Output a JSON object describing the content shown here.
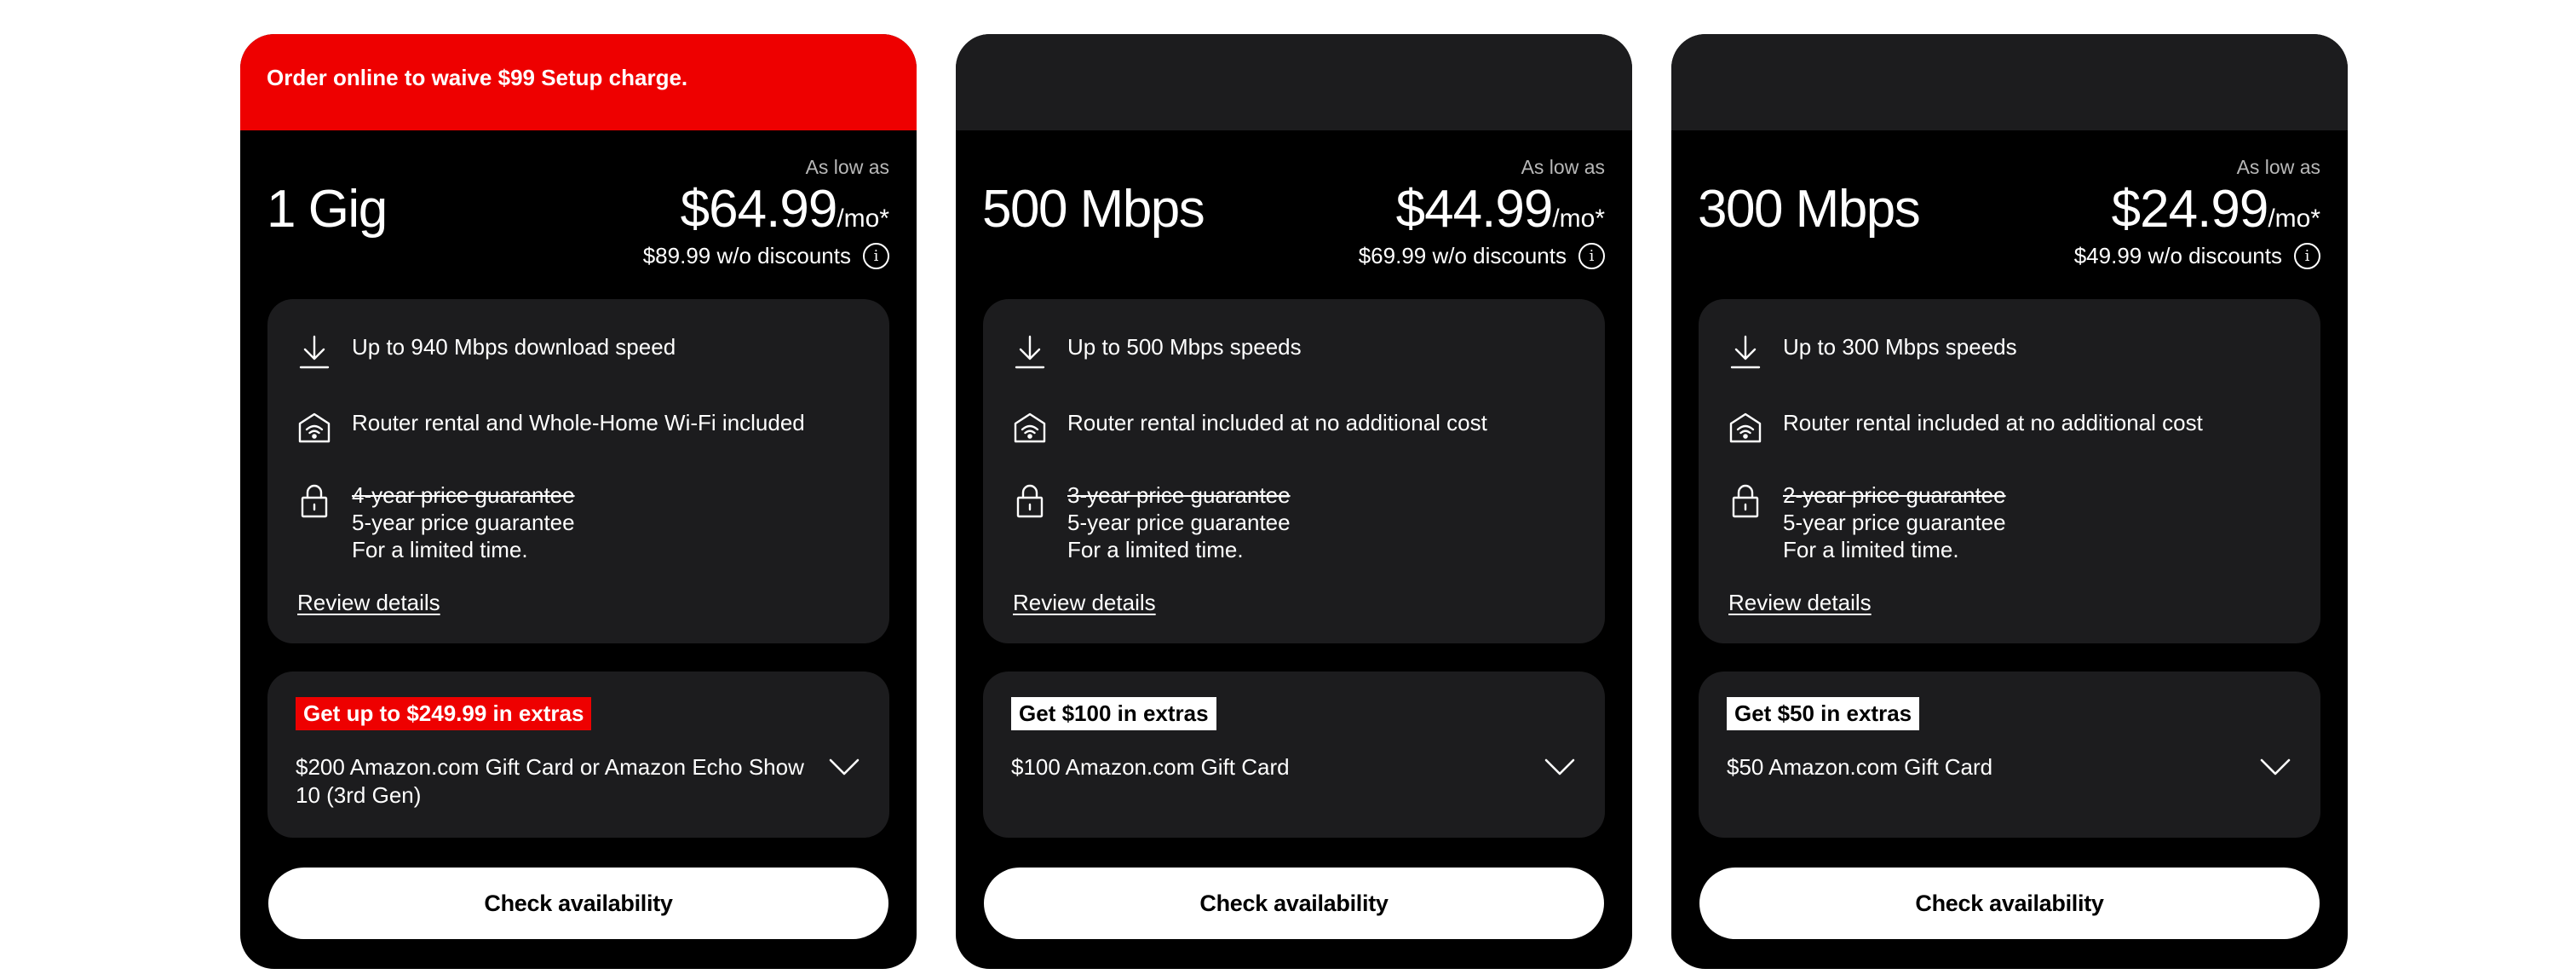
{
  "colors": {
    "brand_red": "#ee0000",
    "card_bg": "#000000",
    "panel_bg": "#1c1c1e",
    "muted_text": "#b8b8b8"
  },
  "cards": [
    {
      "promo": "Order online to waive $99 Setup charge.",
      "plan_name": "1 Gig",
      "as_low_as": "As low as",
      "price": "$64.99",
      "price_unit": "/mo*",
      "without_discounts": "$89.99 w/o discounts",
      "features": [
        {
          "icon": "download-icon",
          "text": "Up to 940 Mbps download speed"
        },
        {
          "icon": "wifi-home-icon",
          "text": "Router rental and Whole-Home Wi-Fi included"
        },
        {
          "icon": "lock-icon",
          "old": "4-year price guarantee",
          "new": "5-year price guarantee",
          "note": "For a limited time."
        }
      ],
      "review_label": "Review details",
      "extras_badge": "Get up to $249.99 in extras",
      "extras_desc": "$200 Amazon.com Gift Card or Amazon Echo Show 10 (3rd Gen)",
      "cta": "Check availability"
    },
    {
      "promo": "",
      "plan_name": "500 Mbps",
      "as_low_as": "As low as",
      "price": "$44.99",
      "price_unit": "/mo*",
      "without_discounts": "$69.99 w/o discounts",
      "features": [
        {
          "icon": "download-icon",
          "text": "Up to 500 Mbps speeds"
        },
        {
          "icon": "wifi-home-icon",
          "text": "Router rental included at no additional cost"
        },
        {
          "icon": "lock-icon",
          "old": "3-year price guarantee",
          "new": "5-year price guarantee",
          "note": "For a limited time."
        }
      ],
      "review_label": "Review details",
      "extras_badge": "Get $100 in extras",
      "extras_desc": "$100 Amazon.com Gift Card",
      "cta": "Check availability"
    },
    {
      "promo": "",
      "plan_name": "300 Mbps",
      "as_low_as": "As low as",
      "price": "$24.99",
      "price_unit": "/mo*",
      "without_discounts": "$49.99 w/o discounts",
      "features": [
        {
          "icon": "download-icon",
          "text": "Up to 300 Mbps speeds"
        },
        {
          "icon": "wifi-home-icon",
          "text": "Router rental included at no additional cost"
        },
        {
          "icon": "lock-icon",
          "old": "2-year price guarantee",
          "new": "5-year price guarantee",
          "note": "For a limited time."
        }
      ],
      "review_label": "Review details",
      "extras_badge": "Get $50 in extras",
      "extras_desc": "$50 Amazon.com Gift Card",
      "cta": "Check availability"
    }
  ]
}
